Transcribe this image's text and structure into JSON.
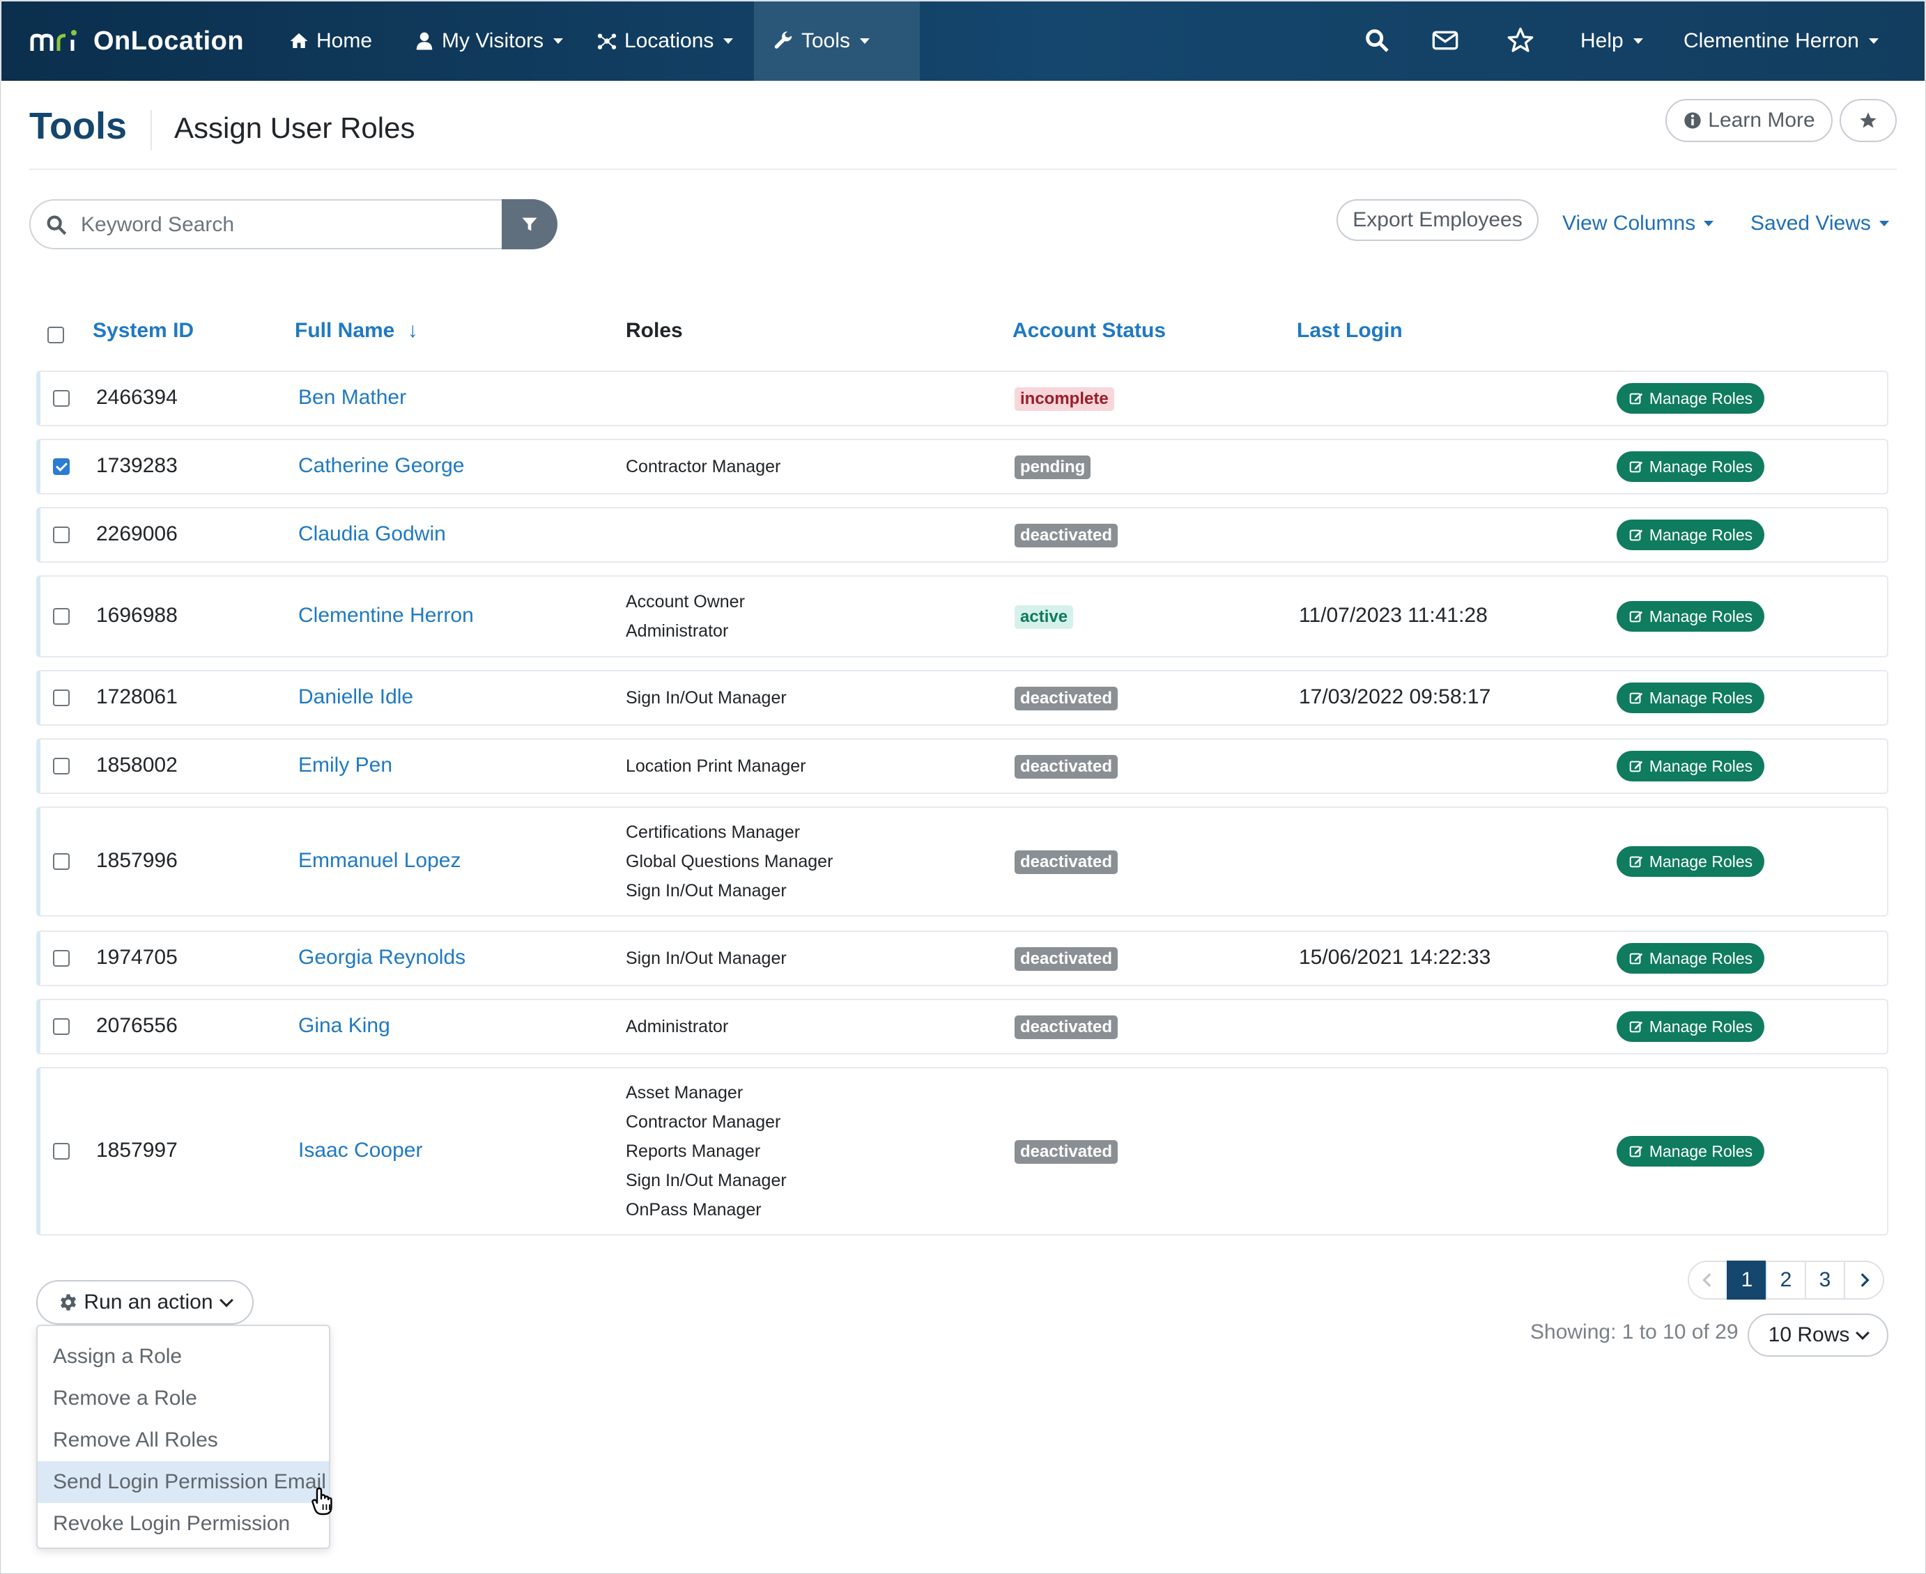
{
  "nav": {
    "brand": "OnLocation",
    "items": [
      {
        "label": "Home",
        "icon": "home-icon"
      },
      {
        "label": "My Visitors",
        "icon": "user-icon"
      },
      {
        "label": "Locations",
        "icon": "network-icon"
      },
      {
        "label": "Tools",
        "icon": "wrench-icon"
      }
    ],
    "help": "Help",
    "user": "Clementine Herron"
  },
  "header": {
    "title": "Tools",
    "subtitle": "Assign User Roles",
    "learn_more": "Learn More"
  },
  "toolbar": {
    "search_placeholder": "Keyword Search",
    "export": "Export Employees",
    "view_columns": "View Columns",
    "saved_views": "Saved Views"
  },
  "table": {
    "columns": {
      "system_id": "System ID",
      "full_name": "Full Name",
      "sort_arrow": "↓",
      "roles": "Roles",
      "account_status": "Account Status",
      "last_login": "Last Login"
    },
    "manage_label": "Manage Roles",
    "rows": [
      {
        "id": "2466394",
        "name": "Ben Mather",
        "roles": [],
        "status": "incomplete",
        "last_login": "",
        "checked": false
      },
      {
        "id": "1739283",
        "name": "Catherine George",
        "roles": [
          "Contractor Manager"
        ],
        "status": "pending",
        "last_login": "",
        "checked": true
      },
      {
        "id": "2269006",
        "name": "Claudia Godwin",
        "roles": [],
        "status": "deactivated",
        "last_login": "",
        "checked": false
      },
      {
        "id": "1696988",
        "name": "Clementine Herron",
        "roles": [
          "Account Owner",
          "Administrator"
        ],
        "status": "active",
        "last_login": "11/07/2023 11:41:28",
        "checked": false
      },
      {
        "id": "1728061",
        "name": "Danielle Idle",
        "roles": [
          "Sign In/Out Manager"
        ],
        "status": "deactivated",
        "last_login": "17/03/2022 09:58:17",
        "checked": false
      },
      {
        "id": "1858002",
        "name": "Emily Pen",
        "roles": [
          "Location Print Manager"
        ],
        "status": "deactivated",
        "last_login": "",
        "checked": false
      },
      {
        "id": "1857996",
        "name": "Emmanuel Lopez",
        "roles": [
          "Certifications Manager",
          "Global Questions Manager",
          "Sign In/Out Manager"
        ],
        "status": "deactivated",
        "last_login": "",
        "checked": false
      },
      {
        "id": "1974705",
        "name": "Georgia Reynolds",
        "roles": [
          "Sign In/Out Manager"
        ],
        "status": "deactivated",
        "last_login": "15/06/2021 14:22:33",
        "checked": false
      },
      {
        "id": "2076556",
        "name": "Gina King",
        "roles": [
          "Administrator"
        ],
        "status": "deactivated",
        "last_login": "",
        "checked": false
      },
      {
        "id": "1857997",
        "name": "Isaac Cooper",
        "roles": [
          "Asset Manager",
          "Contractor Manager",
          "Reports Manager",
          "Sign In/Out Manager",
          "OnPass Manager"
        ],
        "status": "deactivated",
        "last_login": "",
        "checked": false
      }
    ]
  },
  "actions": {
    "button": "Run an action",
    "menu": [
      "Assign a Role",
      "Remove a Role",
      "Remove All Roles",
      "Send Login Permission Email",
      "Revoke Login Permission"
    ],
    "highlighted_index": 3
  },
  "pagination": {
    "pages": [
      "1",
      "2",
      "3"
    ],
    "current": "1",
    "showing": "Showing: 1 to 10 of 29",
    "rows_per_page": "10 Rows"
  },
  "colors": {
    "navy": "#15466d",
    "link": "#1f79c2",
    "manage_green": "#0f7b5f",
    "badge_gray": "#8a8f94"
  }
}
